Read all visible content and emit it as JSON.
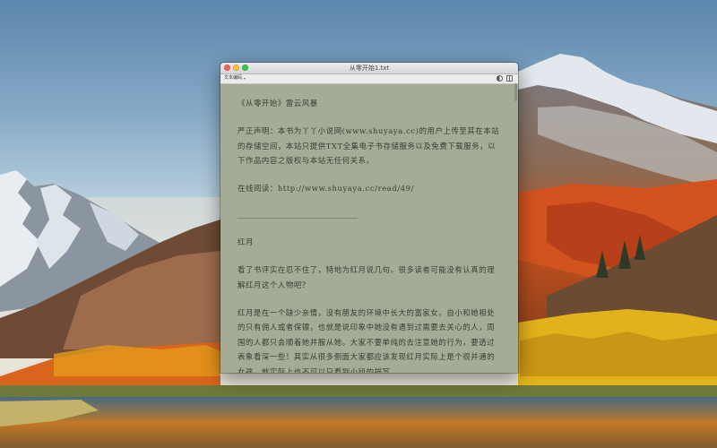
{
  "window": {
    "title": "从零开始1.txt",
    "encoding_label": "文本编码",
    "icons": [
      "contrast-icon",
      "sidebar-icon"
    ]
  },
  "document": {
    "paragraphs": [
      "《从零开始》雷云风暴",
      "严正声明：本书为丫丫小说网(www.shuyaya.cc)的用户上传至其在本站的存储空间，本站只提供TXT全集电子书存储服务以及免费下载服务，以下作品内容之版权与本站无任何关系。",
      "在线阅读：http://www.shuyaya.cc/read/49/",
      "________________________________",
      "红月",
      "看了书评实在忍不住了，特地为红月说几句。很多读者可能没有认真的理解红月这个人物吧？",
      "红月是在一个缺少亲情，没有朋友的环境中长大的富家女。自小和她相处的只有佣人或者保镖，也就是说印象中她没有遇到过需要去关心的人，周围的人都只会顺着她并服从她。大家不要单纯的去注意她的行为，要透过表象看深一些！其实从很多侧面大家都应该发现红月实际上是个很并通的女孩，就实际上也不可以只看到小段的描写..."
    ]
  },
  "colors": {
    "page_background": "#a4ab96",
    "text": "#3a3d34"
  }
}
